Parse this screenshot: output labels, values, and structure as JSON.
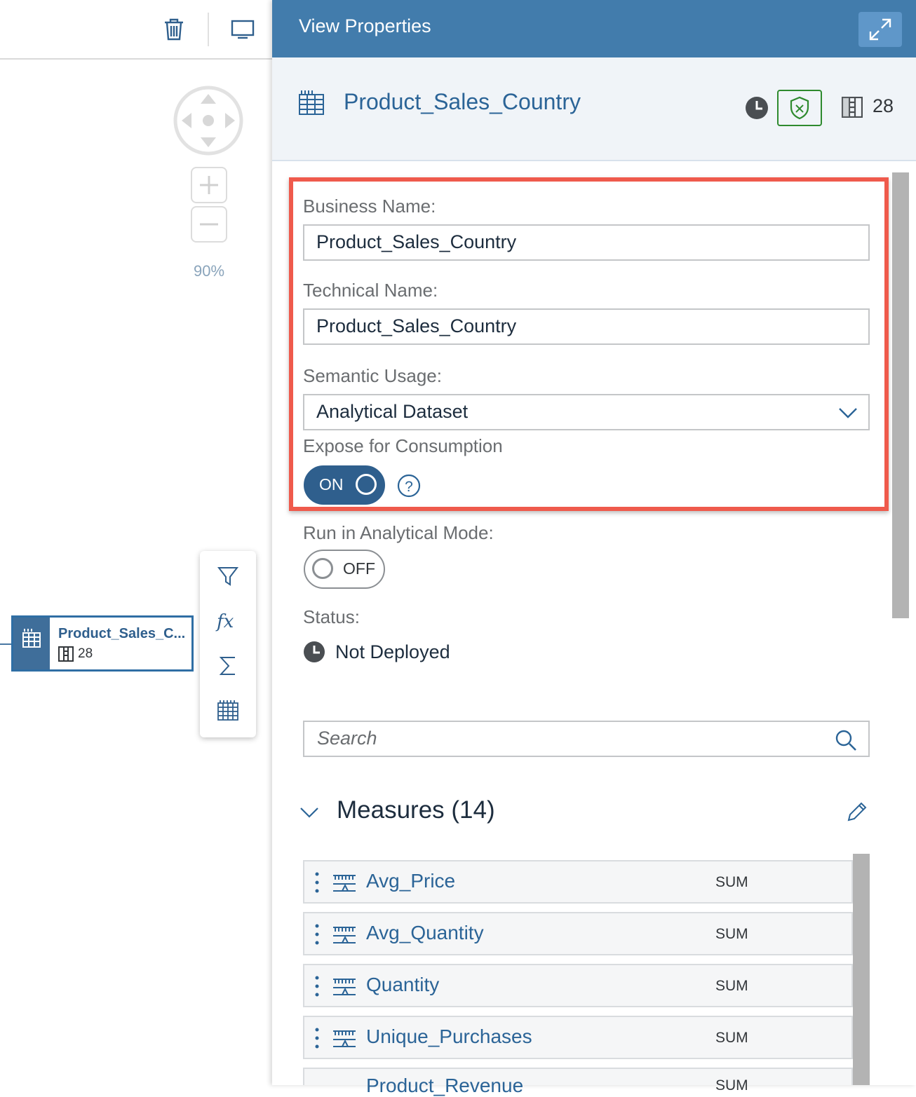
{
  "canvas": {
    "zoom_level": "90%",
    "node": {
      "name": "Product_Sales_C...",
      "column_count": "28"
    }
  },
  "panel": {
    "title": "View Properties",
    "object": {
      "name": "Product_Sales_Country",
      "column_count": "28"
    },
    "form": {
      "business_name_label": "Business Name:",
      "business_name_value": "Product_Sales_Country",
      "technical_name_label": "Technical Name:",
      "technical_name_value": "Product_Sales_Country",
      "semantic_usage_label": "Semantic Usage:",
      "semantic_usage_value": "Analytical Dataset",
      "expose_label": "Expose for Consumption",
      "expose_toggle": "ON",
      "analytical_mode_label": "Run in Analytical Mode:",
      "analytical_mode_toggle": "OFF",
      "status_label": "Status:",
      "status_value": "Not Deployed"
    },
    "search": {
      "placeholder": "Search"
    },
    "measures": {
      "title": "Measures (14)",
      "items": [
        {
          "name": "Avg_Price",
          "aggregation": "SUM"
        },
        {
          "name": "Avg_Quantity",
          "aggregation": "SUM"
        },
        {
          "name": "Quantity",
          "aggregation": "SUM"
        },
        {
          "name": "Unique_Purchases",
          "aggregation": "SUM"
        },
        {
          "name": "Product_Revenue",
          "aggregation": "SUM"
        }
      ]
    }
  },
  "colors": {
    "header_blue": "#427cac",
    "object_name_blue": "#2b6497",
    "highlight_red": "#ef5a4c",
    "toggle_on": "#2f5f8d",
    "shield_green": "#2e8a2e"
  }
}
